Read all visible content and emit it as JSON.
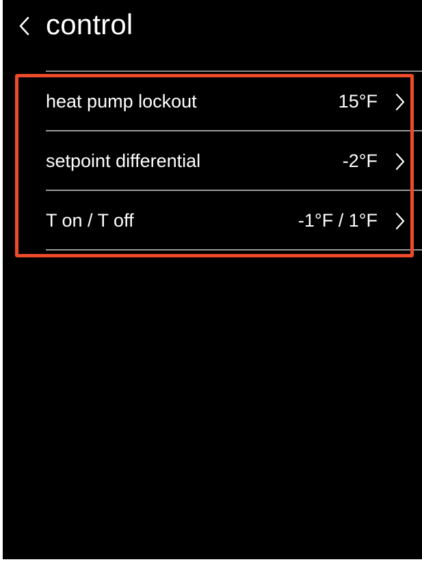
{
  "header": {
    "back_icon": "chevron-left-icon",
    "title": "control"
  },
  "settings": [
    {
      "label": "heat pump lockout",
      "value": "15°F",
      "icon": "chevron-right-icon"
    },
    {
      "label": "setpoint differential",
      "value": "-2°F",
      "icon": "chevron-right-icon"
    },
    {
      "label": "T on / T off",
      "value": "-1°F / 1°F",
      "icon": "chevron-right-icon"
    }
  ],
  "colors": {
    "background": "#000000",
    "text": "#ffffff",
    "divider": "#9a9a9a",
    "highlight": "#ee4b2b"
  }
}
